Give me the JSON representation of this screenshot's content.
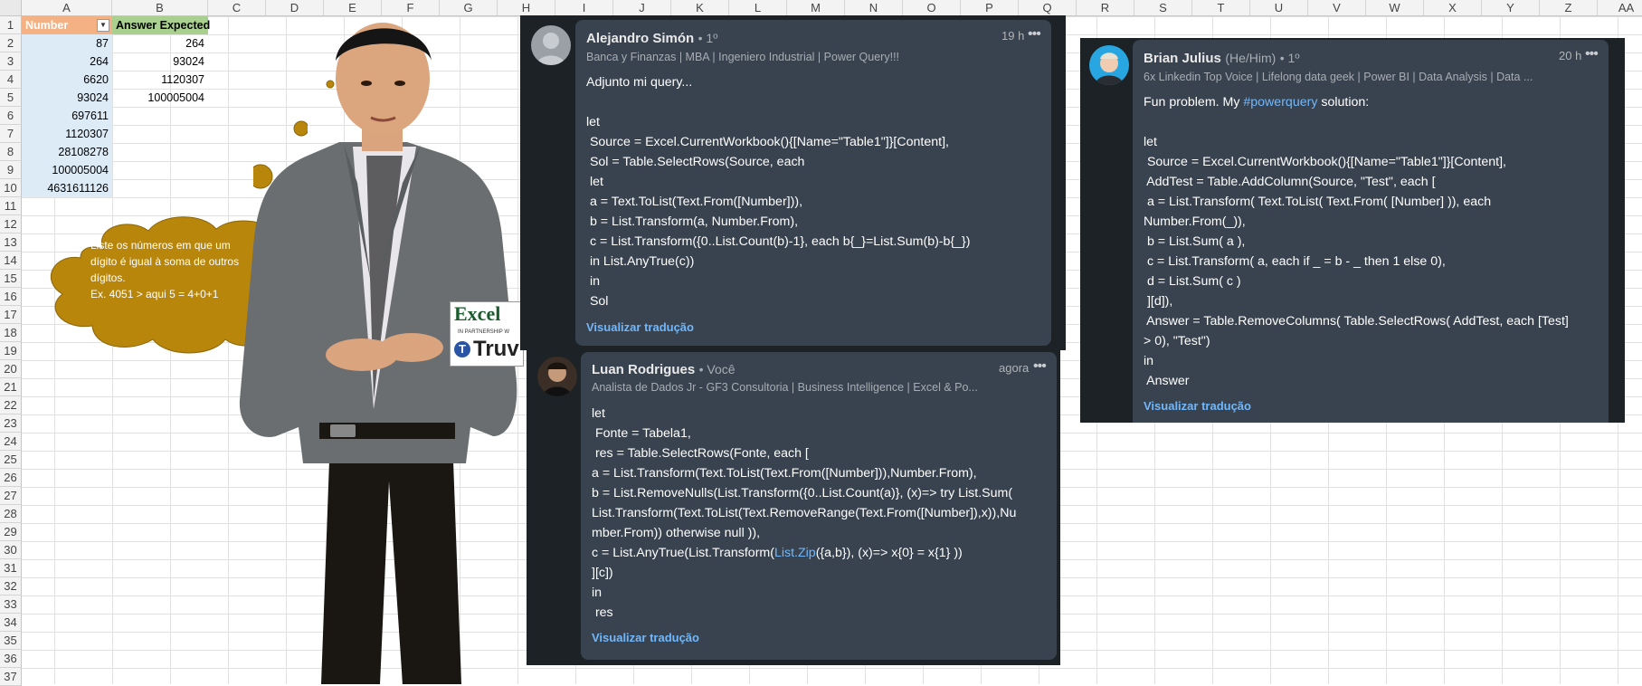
{
  "sheet": {
    "columns": [
      "A",
      "B",
      "C",
      "D",
      "E",
      "F",
      "G",
      "H",
      "I",
      "J",
      "K",
      "L",
      "M",
      "N",
      "O",
      "P",
      "Q",
      "R",
      "S",
      "T",
      "U",
      "V",
      "W",
      "X",
      "Y",
      "Z",
      "AA"
    ],
    "rows": [
      "1",
      "2",
      "3",
      "4",
      "5",
      "6",
      "7",
      "8",
      "9",
      "10",
      "11",
      "12",
      "13",
      "14",
      "15",
      "16",
      "17",
      "18",
      "19",
      "20",
      "21",
      "22",
      "23",
      "24",
      "25",
      "26",
      "27",
      "28",
      "29",
      "30",
      "31",
      "32",
      "33",
      "34",
      "35",
      "36",
      "37"
    ],
    "header_number": "Number",
    "header_expected": "Answer Expected",
    "numbers": [
      "87",
      "264",
      "6620",
      "93024",
      "697611",
      "1120307",
      "28108278",
      "100005004",
      "4631611126"
    ],
    "expected": [
      "264",
      "93024",
      "1120307",
      "100005004"
    ],
    "header_number_color": "#f4b183",
    "header_expected_color": "#a9d08e",
    "number_cell_color": "#ddebf7"
  },
  "bubble": {
    "lines": [
      "Liste os números em que um",
      "dígito é igual à soma de outros",
      "dígitos.",
      "Ex. 4051 > aqui 5 = 4+0+1"
    ],
    "color": "#b8860b"
  },
  "logo": {
    "brand": "Excel",
    "partner": "IN PARTNERSHIP W",
    "partner_name": "Truv"
  },
  "comment1": {
    "name": "Alejandro Simón",
    "degree": "• 1º",
    "subtitle": "Banca y Finanzas | MBA | Ingeniero Industrial | Power Query!!!",
    "time": "19 h",
    "dots": "•••",
    "lines": [
      "Adjunto mi query...",
      "",
      "let",
      " Source = Excel.CurrentWorkbook(){[Name=\"Table1\"]}[Content],",
      " Sol = Table.SelectRows(Source, each",
      " let",
      " a = Text.ToList(Text.From([Number])),",
      " b = List.Transform(a, Number.From),",
      " c = List.Transform({0..List.Count(b)-1}, each b{_}=List.Sum(b)-b{_})",
      " in List.AnyTrue(c))",
      " in",
      " Sol"
    ],
    "translate": "Visualizar tradução"
  },
  "comment2": {
    "name": "Luan Rodrigues",
    "degree": "• Você",
    "subtitle": "Analista de Dados Jr - GF3 Consultoria | Business Intelligence | Excel & Po...",
    "time": "agora",
    "dots": "•••",
    "lines": [
      "let",
      " Fonte = Tabela1,",
      " res = Table.SelectRows(Fonte, each [",
      "a = List.Transform(Text.ToList(Text.From([Number])),Number.From),",
      "b = List.RemoveNulls(List.Transform({0..List.Count(a)}, (x)=> try List.Sum(",
      "List.Transform(Text.ToList(Text.RemoveRange(Text.From([Number]),x)),Nu",
      "mber.From)) otherwise null )),"
    ],
    "line_c_pre": "c = List.AnyTrue(List.Transform(",
    "line_c_link": "List.Zip",
    "line_c_post": "({a,b}), (x)=> x{0} = x{1} ))",
    "lines_end": [
      "][c])",
      "in",
      " res"
    ],
    "translate": "Visualizar tradução"
  },
  "comment3": {
    "name": "Brian Julius",
    "pronoun": "(He/Him)",
    "degree": "• 1º",
    "subtitle": "6x Linkedin Top Voice | Lifelong data geek | Power BI | Data Analysis | Data ...",
    "time": "20 h",
    "dots": "•••",
    "intro_pre": "Fun problem. My ",
    "intro_link": "#powerquery",
    "intro_post": " solution:",
    "lines": [
      "",
      "let",
      " Source = Excel.CurrentWorkbook(){[Name=\"Table1\"]}[Content],",
      " AddTest = Table.AddColumn(Source, \"Test\", each [",
      " a = List.Transform( Text.ToList( Text.From( [Number] )), each",
      "Number.From(_)),",
      " b = List.Sum( a ),",
      " c = List.Transform( a, each if _ = b - _ then 1 else 0),",
      " d = List.Sum( c )",
      " ][d]),",
      " Answer = Table.RemoveColumns( Table.SelectRows( AddTest, each [Test]",
      "> 0), \"Test\")",
      "in",
      " Answer"
    ],
    "translate": "Visualizar tradução"
  }
}
